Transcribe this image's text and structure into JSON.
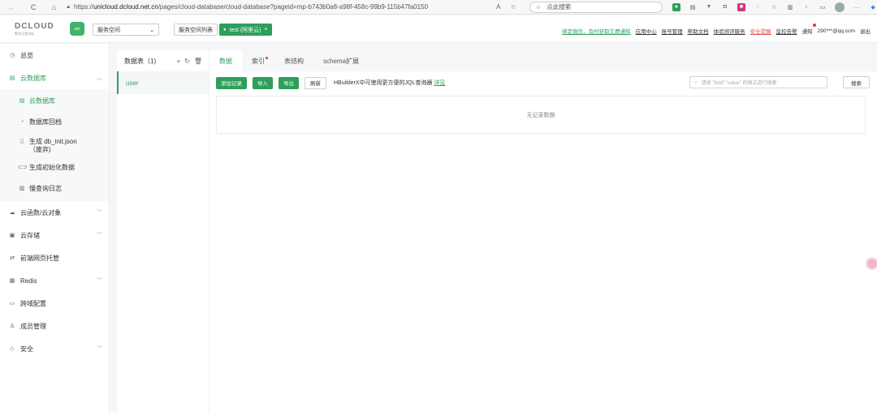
{
  "browser": {
    "url_scheme": "https://",
    "url_host": "unicloud.dcloud.net.cn",
    "url_path": "/pages/cloud-database/cloud-database?pageid=mp-b743b0a8-a98f-458c-99b9-115b47fa0150",
    "search_placeholder": "点此搜索"
  },
  "header": {
    "logo_text": "DCLOUD",
    "logo_sub": "数字天堂科技",
    "uni_badge": "uni",
    "space_select": "服务空间",
    "space_list_btn": "服务空间列表",
    "active_space": "test (阿里云)",
    "links": {
      "wechat": "绑定微信，及时获取欠费通知",
      "app_center": "应用中心",
      "account": "账号管理",
      "docs": "帮助文档",
      "evaluate": "体验测评服务",
      "risk": "安全提醒",
      "alarm": "监控告警",
      "notice": "通知",
      "user": "290***@qq.com",
      "logout": "退出"
    }
  },
  "sidebar": {
    "overview": "总览",
    "cloud_db": "云数据库",
    "sub": {
      "cloud_db": "云数据库",
      "backup": "数据库回档",
      "gen_init": "生成 db_init.json（废弃)",
      "gen_data": "生成初始化数据",
      "slow_log": "慢查询日志"
    },
    "functions": "云函数/云对象",
    "storage": "云存储",
    "hosting": "前端网页托管",
    "redis": "Redis",
    "cors": "跨域配置",
    "members": "成员管理",
    "security": "安全"
  },
  "tables": {
    "header": "数据表（1)",
    "items": [
      "user"
    ]
  },
  "tabs": [
    "数据",
    "索引",
    "表结构",
    "schema扩展"
  ],
  "toolbar": {
    "add": "添加记录",
    "import": "导入",
    "export": "导出",
    "refresh": "刷新",
    "hint": "HBuilderX中可使用更方便的JQL查询器",
    "hint_link": "详见",
    "query_placeholder": "请按 \"field\":\"value\" 的格式进行搜索",
    "search": "搜索"
  },
  "empty_text": "无记录数据",
  "colors": {
    "brand_green": "#2e9e5b",
    "alert_red": "#e55353"
  }
}
